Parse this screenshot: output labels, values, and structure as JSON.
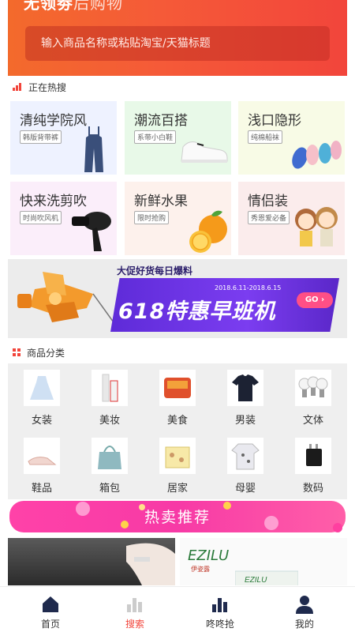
{
  "header": {
    "title_bold": "无领劵",
    "title_thin": "后购物",
    "search_placeholder": "输入商品名称或粘贴淘宝/天猫标题"
  },
  "hot_section": {
    "title": "正在热搜",
    "items": [
      {
        "title": "清纯学院风",
        "tag": "韩版背带裤",
        "bg": "#eef2ff"
      },
      {
        "title": "潮流百搭",
        "tag": "系带小白鞋",
        "bg": "#e8f9e8"
      },
      {
        "title": "浅口隐形",
        "tag": "纯棉船袜",
        "bg": "#f8fbe6"
      },
      {
        "title": "快来洗剪吹",
        "tag": "时尚吹风机",
        "bg": "#fbeefa"
      },
      {
        "title": "新鲜水果",
        "tag": "限时抢购",
        "bg": "#fdf1ec"
      },
      {
        "title": "情侣装",
        "tag": "秀恩爱必备",
        "bg": "#fbecec"
      }
    ]
  },
  "banner": {
    "subtitle": "大促好货每日爆料",
    "dates": "2018.6.11-2018.6.15",
    "headline": "618特惠早班机",
    "go_label": "GO"
  },
  "category_section": {
    "title": "商品分类",
    "items": [
      {
        "label": "女装",
        "icon": "dress-icon"
      },
      {
        "label": "美妆",
        "icon": "cosmetics-icon"
      },
      {
        "label": "美食",
        "icon": "food-icon"
      },
      {
        "label": "男装",
        "icon": "tshirt-icon"
      },
      {
        "label": "文体",
        "icon": "lightbulb-icon"
      },
      {
        "label": "鞋品",
        "icon": "sandal-icon"
      },
      {
        "label": "箱包",
        "icon": "handbag-icon"
      },
      {
        "label": "居家",
        "icon": "storage-box-icon"
      },
      {
        "label": "母婴",
        "icon": "baby-clothes-icon"
      },
      {
        "label": "数码",
        "icon": "charger-icon"
      }
    ]
  },
  "hot_sale": {
    "title": "热卖推荐"
  },
  "products": [
    {
      "brand": ""
    },
    {
      "brand": "EZILU",
      "brand_sub": "伊姿露"
    }
  ],
  "nav": {
    "items": [
      {
        "label": "首页",
        "icon": "home-icon",
        "active": false
      },
      {
        "label": "搜索",
        "icon": "chart-bars-icon",
        "active": true
      },
      {
        "label": "咚咚抢",
        "icon": "stats-bars-icon",
        "active": false
      },
      {
        "label": "我的",
        "icon": "user-icon",
        "active": false
      }
    ]
  },
  "colors": {
    "accent": "#f2453b",
    "hot_pink": "#ff42a8",
    "banner_purple": "#6a31e0"
  }
}
